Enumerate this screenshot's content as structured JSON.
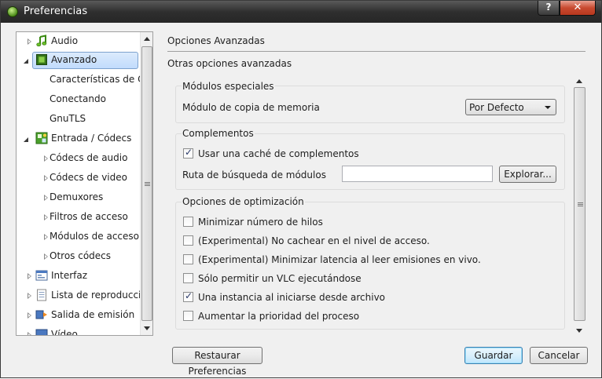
{
  "window": {
    "title": "Preferencias",
    "help_label": "?",
    "close_label": "✕"
  },
  "sidebar": {
    "items": [
      {
        "label": "Audio",
        "icon": "music-note-icon"
      },
      {
        "label": "Avanzado",
        "icon": "chip-icon"
      },
      {
        "label": "Características de CPU"
      },
      {
        "label": "Conectando"
      },
      {
        "label": "GnuTLS"
      },
      {
        "label": "Entrada / Códecs",
        "icon": "input-codecs-icon"
      },
      {
        "label": "Códecs de audio"
      },
      {
        "label": "Códecs de video"
      },
      {
        "label": "Demuxores"
      },
      {
        "label": "Filtros de acceso"
      },
      {
        "label": "Módulos de acceso"
      },
      {
        "label": "Otros códecs"
      },
      {
        "label": "Interfaz",
        "icon": "interface-icon"
      },
      {
        "label": "Lista de reproducción",
        "icon": "playlist-icon"
      },
      {
        "label": "Salida de emisión",
        "icon": "stream-output-icon"
      },
      {
        "label": "Vídeo",
        "icon": "video-icon"
      }
    ]
  },
  "panel": {
    "heading": "Opciones Avanzadas",
    "subheading": "Otras opciones avanzadas",
    "groups": {
      "special": {
        "title": "Módulos especiales",
        "memcpy_label": "Módulo de copia de memoria",
        "memcpy_value": "Por Defecto"
      },
      "plugins": {
        "title": "Complementos",
        "cache_label": "Usar una caché de complementos",
        "path_label": "Ruta de búsqueda de módulos",
        "path_value": "",
        "browse_label": "Explorar..."
      },
      "optimization": {
        "title": "Opciones de optimización",
        "options": [
          {
            "label": "Minimizar número de hilos",
            "checked": false
          },
          {
            "label": "(Experimental) No cachear en el nivel de acceso.",
            "checked": false
          },
          {
            "label": "(Experimental) Minimizar latencia al leer emisiones en vivo.",
            "checked": false
          },
          {
            "label": "Sólo permitir un VLC ejecutándose",
            "checked": false
          },
          {
            "label": "Una instancia al iniciarse desde archivo",
            "checked": true
          },
          {
            "label": "Aumentar la prioridad del proceso",
            "checked": false
          }
        ]
      }
    }
  },
  "footer": {
    "reset_label": "Restaurar Preferencias",
    "save_label": "Guardar",
    "cancel_label": "Cancelar"
  },
  "colors": {
    "selection": "#c1dbfc",
    "selection_border": "#7da2ce",
    "titlebar": "#2f2f2f",
    "close": "#c84a30"
  }
}
